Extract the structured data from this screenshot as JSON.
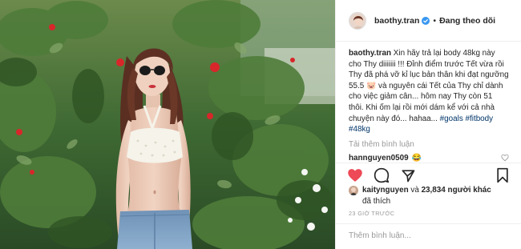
{
  "post": {
    "author": {
      "username": "baothy.tran",
      "verified": true,
      "follow_status": "Đang theo dõi"
    },
    "caption": {
      "username": "baothy.tran",
      "text": "Xin hãy trả lại body 48kg này cho Thy diiiiiii !!! Đỉnh điểm trước Tết vừa rồi Thy đã phá vỡ kỉ lục bản thân khi đạt ngưỡng 55.5 🐷 và nguyên cái Tết của Thy chỉ dành cho việc giảm cân... hôm nay Thy còn 51 thôi. Khi ốm lại rồi mới dám kể với cả nhà chuyện này đó... hahaa...",
      "hashtags": [
        "#goals",
        "#fitbody",
        "#48kg"
      ]
    },
    "load_more_label": "Tải thêm bình luận",
    "comments": [
      {
        "username": "hannguyen0509",
        "text": "😂"
      }
    ],
    "likes": {
      "user": "kaitynguyen",
      "connector": "và",
      "count": "23,834",
      "others_label": "người khác",
      "suffix": "đã thích"
    },
    "timestamp": "23 GIỜ TRƯỚC",
    "add_comment_placeholder": "Thêm bình luận...",
    "colors": {
      "liked_heart": "#ed4956",
      "verified_badge": "#3897f0",
      "hashtag": "#003569",
      "muted_text": "#999999"
    },
    "icons": {
      "like": "heart-filled-icon",
      "comment": "comment-bubble-icon",
      "share": "share-arrow-icon",
      "save": "bookmark-icon"
    }
  }
}
